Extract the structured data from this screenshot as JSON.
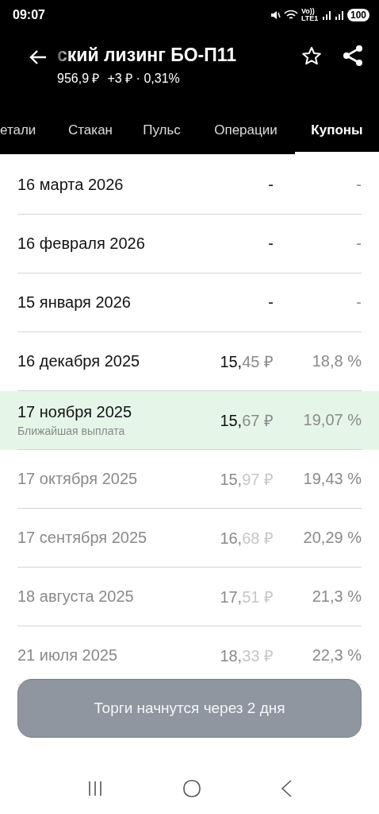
{
  "status_bar": {
    "time": "09:07",
    "battery": "100",
    "volte": "Vo)) LTE1"
  },
  "header": {
    "title": "ский лизинг БО-П11",
    "price": "956,9 ₽",
    "change": "+3 ₽ · 0,31%",
    "favorite": false
  },
  "tabs": [
    {
      "label": "етали",
      "selected": false
    },
    {
      "label": "Стакан",
      "selected": false
    },
    {
      "label": "Пульс",
      "selected": false
    },
    {
      "label": "Операции",
      "selected": false
    },
    {
      "label": "Купоны",
      "selected": true
    }
  ],
  "coupons": [
    {
      "date": "16 марта 2026",
      "amount_main": "-",
      "percent": "-",
      "past": false,
      "next": false
    },
    {
      "date": "16 февраля 2026",
      "amount_main": "-",
      "percent": "-",
      "past": false,
      "next": false
    },
    {
      "date": "15 января 2026",
      "amount_main": "-",
      "percent": "-",
      "past": false,
      "next": false
    },
    {
      "date": "16 декабря 2025",
      "amount_main": "15,",
      "amount_fraction": "45 ₽",
      "percent": "18,8 %",
      "past": false,
      "next": false
    },
    {
      "date": "17 ноября 2025",
      "note": "Ближайшая выплата",
      "amount_main": "15,",
      "amount_fraction": "67 ₽",
      "percent": "19,07 %",
      "past": false,
      "next": true
    },
    {
      "date": "17 октября 2025",
      "amount_main": "15,",
      "amount_fraction": "97 ₽",
      "percent": "19,43 %",
      "past": true,
      "next": false
    },
    {
      "date": "17 сентября 2025",
      "amount_main": "16,",
      "amount_fraction": "68 ₽",
      "percent": "20,29 %",
      "past": true,
      "next": false
    },
    {
      "date": "18 августа 2025",
      "amount_main": "17,",
      "amount_fraction": "51 ₽",
      "percent": "21,3 %",
      "past": true,
      "next": false
    },
    {
      "date": "21 июля 2025",
      "amount_main": "18,",
      "amount_fraction": "33 ₽",
      "percent": "22,3 %",
      "past": true,
      "next": false
    }
  ],
  "action_button": {
    "label": "Торги начнутся через 2 дня",
    "disabled": true
  }
}
